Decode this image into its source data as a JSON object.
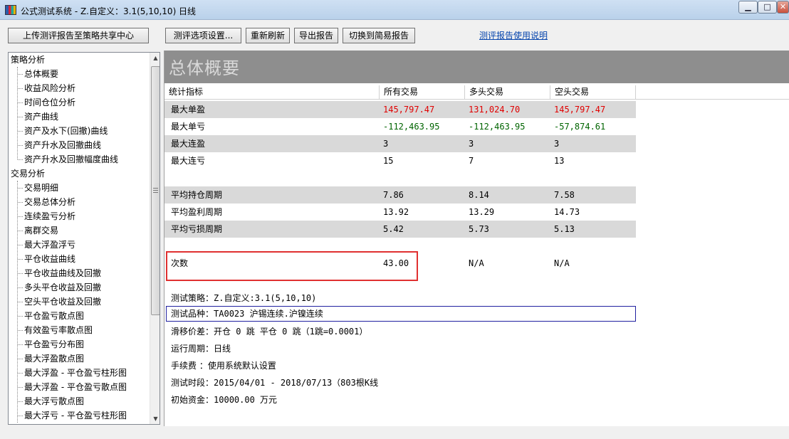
{
  "window": {
    "title": "公式测试系统 - Z.自定义：3.1(5,10,10) 日线",
    "min_label": "▁",
    "max_label": "□",
    "close_label": "✕"
  },
  "toolbar": {
    "upload_label": "上传测评报告至策略共享中心",
    "options_label": "测评选项设置...",
    "refresh_label": "重新刷新",
    "export_label": "导出报告",
    "switch_label": "切换到简易报告",
    "help_link": "测评报告使用说明"
  },
  "sidebar": {
    "strategy_category": "策略分析",
    "strategy_items": [
      "总体概要",
      "收益风险分析",
      "时间仓位分析",
      "资产曲线",
      "资产及水下(回撤)曲线",
      "资产升水及回撤曲线",
      "资产升水及回撤幅度曲线"
    ],
    "trade_category": "交易分析",
    "trade_items": [
      "交易明细",
      "交易总体分析",
      "连续盈亏分析",
      "离群交易",
      "最大浮盈浮亏",
      "平仓收益曲线",
      "平仓收益曲线及回撤",
      "多头平仓收益及回撤",
      "空头平仓收益及回撤",
      "平仓盈亏散点图",
      "有效盈亏率散点图",
      "平仓盈亏分布图",
      "最大浮盈散点图",
      "最大浮盈 - 平仓盈亏柱形图",
      "最大浮盈 - 平仓盈亏散点图",
      "最大浮亏散点图",
      "最大浮亏 - 平仓盈亏柱形图"
    ],
    "selected": "总体概要"
  },
  "report": {
    "banner_title": "总体概要",
    "headers": [
      "统计指标",
      "所有交易",
      "多头交易",
      "空头交易"
    ],
    "rows": [
      {
        "label": "最大单盈",
        "all": "145,797.47",
        "long": "131,024.70",
        "short": "145,797.47"
      },
      {
        "label": "最大单亏",
        "all": "-112,463.95",
        "long": "-112,463.95",
        "short": "-57,874.61"
      },
      {
        "label": "最大连盈",
        "all": "3",
        "long": "3",
        "short": "3"
      },
      {
        "label": "最大连亏",
        "all": "15",
        "long": "7",
        "short": "13"
      },
      {
        "label": "平均持仓周期",
        "all": "7.86",
        "long": "8.14",
        "short": "7.58"
      },
      {
        "label": "平均盈利周期",
        "all": "13.92",
        "long": "13.29",
        "short": "14.73"
      },
      {
        "label": "平均亏损周期",
        "all": "5.42",
        "long": "5.73",
        "short": "5.13"
      },
      {
        "label": "次数",
        "all": "43.00",
        "long": "N/A",
        "short": "N/A"
      }
    ],
    "info": {
      "strategy_label": "测试策略：",
      "strategy_value": "Z.自定义:3.1(5,10,10)",
      "instrument_label": "测试品种：",
      "instrument_value": "TA0023 沪锡连续.沪镍连续",
      "slippage_label": "滑移价差：",
      "slippage_value": "开仓 0 跳 平仓 0 跳（1跳=0.0001）",
      "period_label": "运行周期：",
      "period_value": "日线",
      "fee_label": "手续费  ：",
      "fee_value": "使用系统默认设置",
      "range_label": "测试时段：",
      "range_value": "2015/04/01 - 2018/07/13（803根K线",
      "capital_label": "初始资金：",
      "capital_value": "10000.00 万元"
    }
  },
  "colors": {
    "profit": "#e00000",
    "loss": "#006400",
    "banner": "#8e8e8e",
    "shaded_row": "#d9d9d9",
    "highlight_box": "#e03030",
    "info_box": "#2020a0",
    "link": "#0645ad"
  }
}
